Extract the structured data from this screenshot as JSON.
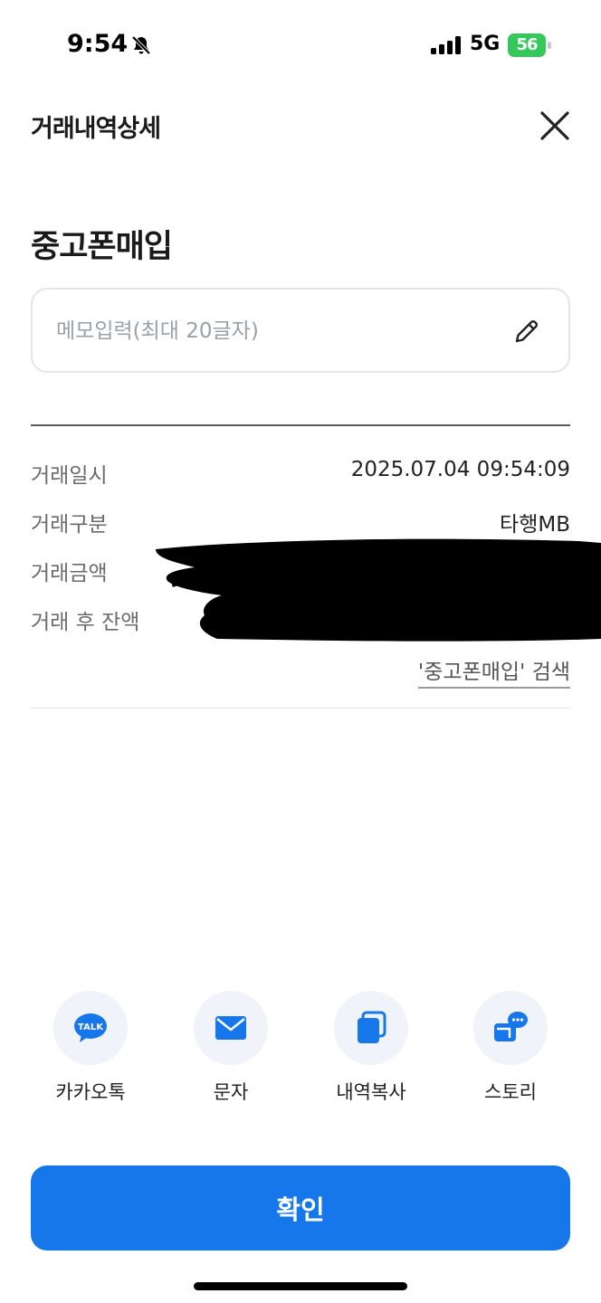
{
  "status_bar": {
    "time": "9:54",
    "network": "5G",
    "battery": "56"
  },
  "header": {
    "title": "거래내역상세"
  },
  "transaction": {
    "title": "중고폰매입",
    "memo": {
      "placeholder": "메모입력(최대 20글자)",
      "value": ""
    },
    "details": [
      {
        "label": "거래일시",
        "value": "2025.07.04 09:54:09"
      },
      {
        "label": "거래구분",
        "value": "타행MB"
      },
      {
        "label": "거래금액",
        "value": ""
      },
      {
        "label": "거래 후 잔액",
        "value": ""
      }
    ],
    "search_link": "'중고폰매입' 검색"
  },
  "share": [
    {
      "label": "카카오톡",
      "icon": "kakaotalk-icon"
    },
    {
      "label": "문자",
      "icon": "mail-icon"
    },
    {
      "label": "내역복사",
      "icon": "copy-icon"
    },
    {
      "label": "스토리",
      "icon": "story-icon"
    }
  ],
  "confirm_label": "확인",
  "colors": {
    "accent": "#1677EA",
    "icon_bg": "#F0F4FA",
    "battery": "#34C759"
  }
}
